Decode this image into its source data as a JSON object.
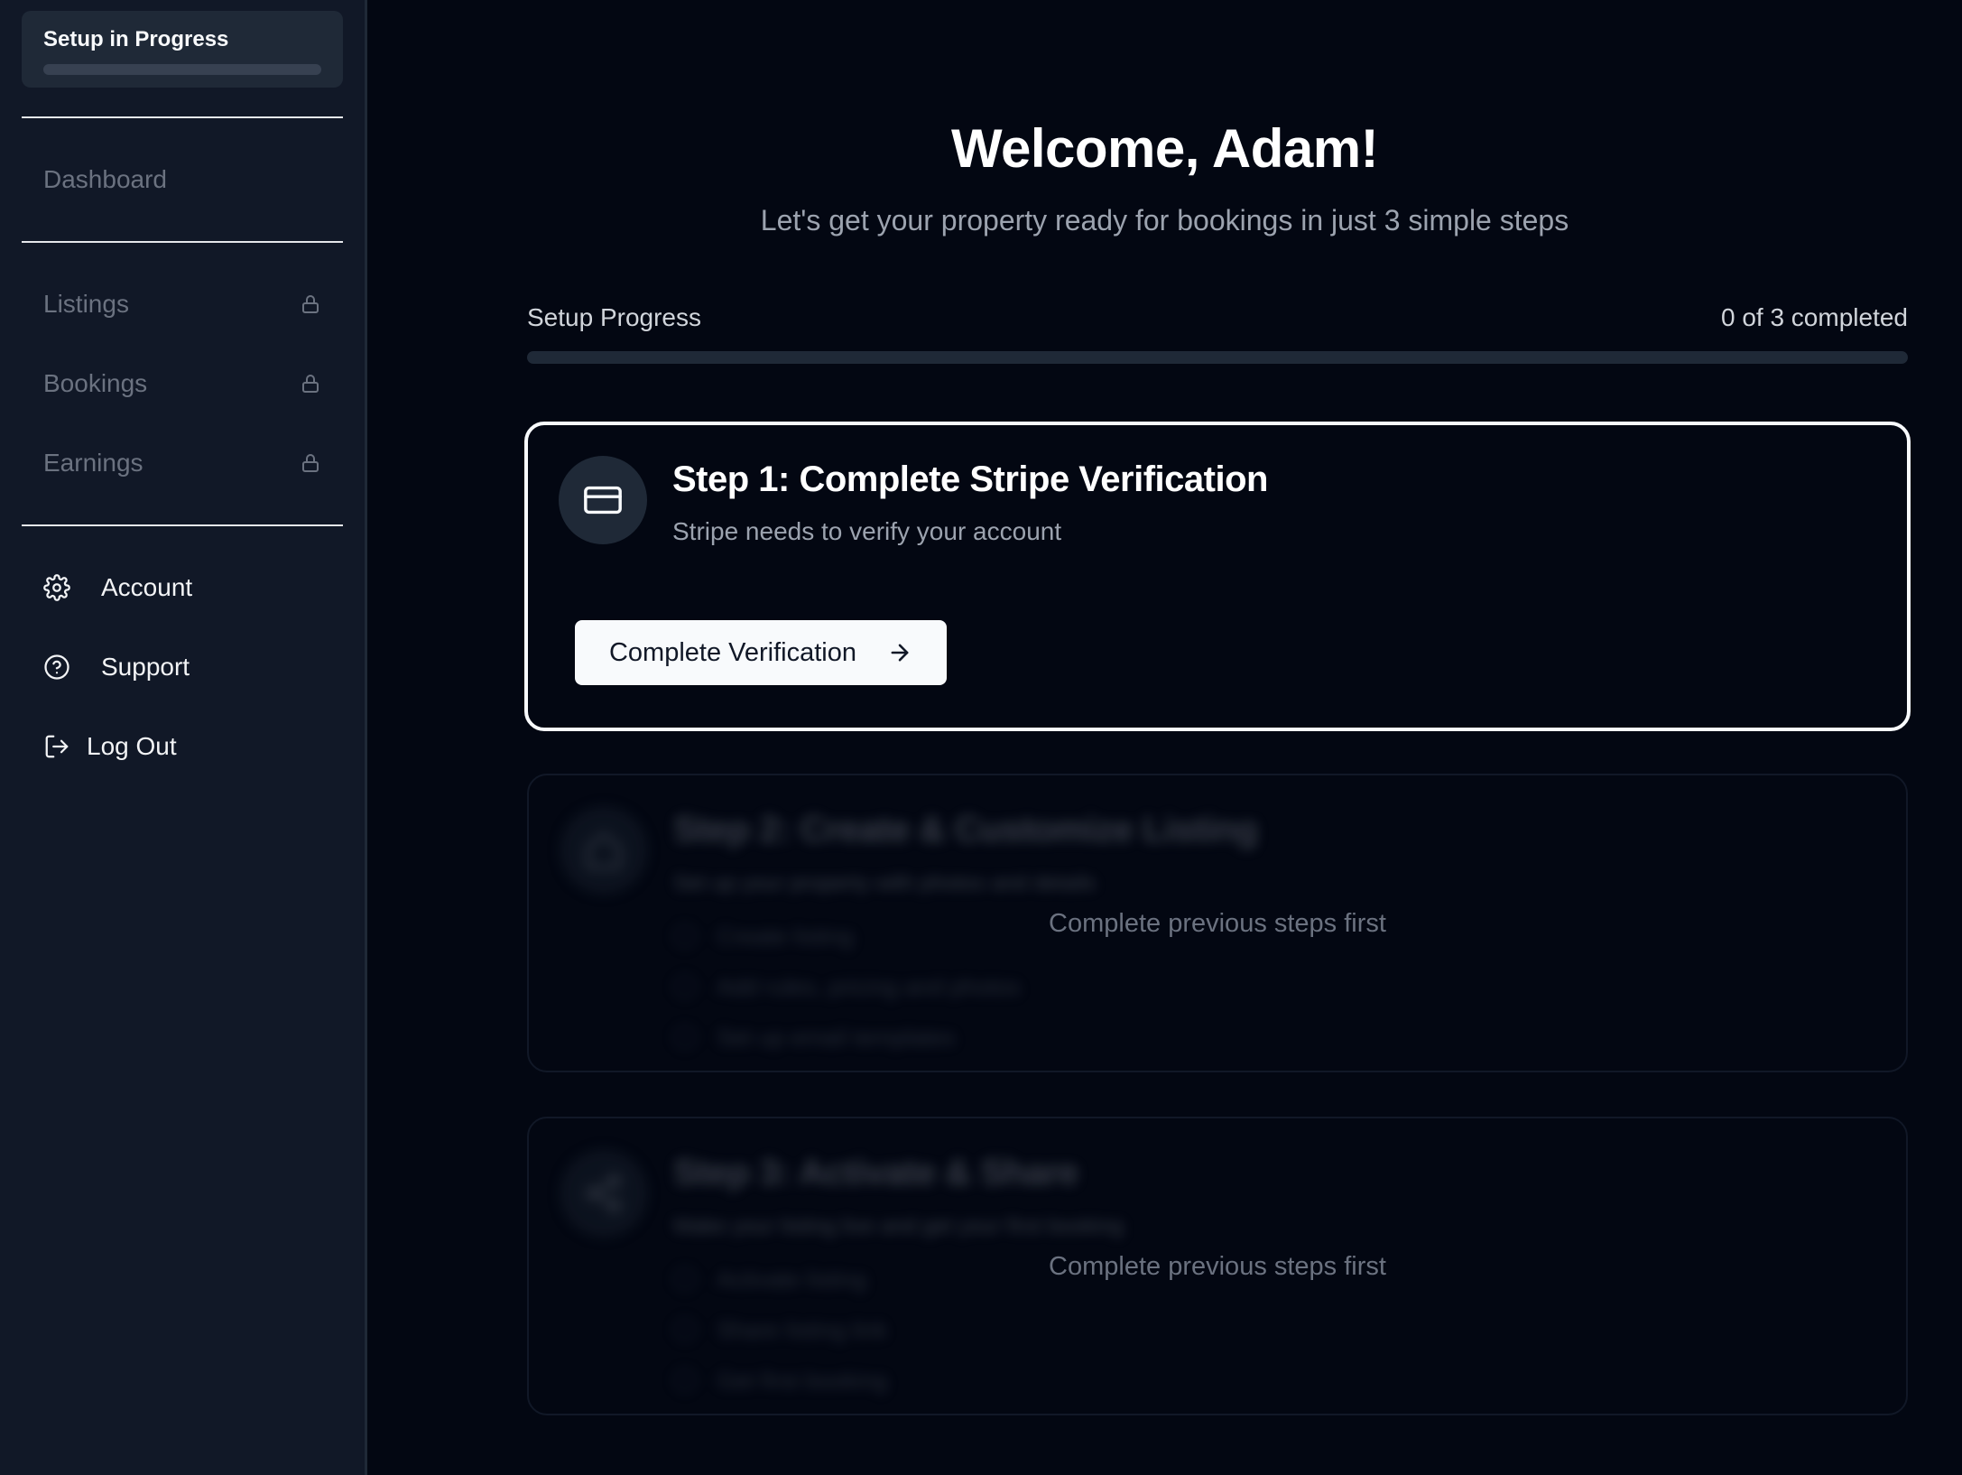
{
  "sidebar": {
    "setup_status": {
      "label": "Setup in Progress",
      "progress": 0
    },
    "nav_top": [
      {
        "label": "Dashboard"
      }
    ],
    "nav_locked": [
      {
        "label": "Listings",
        "icon": "lock-icon"
      },
      {
        "label": "Bookings",
        "icon": "lock-icon"
      },
      {
        "label": "Earnings",
        "icon": "lock-icon"
      }
    ],
    "nav_bottom": [
      {
        "label": "Account",
        "icon": "gear-icon"
      },
      {
        "label": "Support",
        "icon": "help-circle-icon"
      },
      {
        "label": "Log Out",
        "icon": "log-out-icon"
      }
    ]
  },
  "main": {
    "title": "Welcome, Adam!",
    "subtitle": "Let's get your property ready for bookings in just 3 simple steps",
    "progress": {
      "label": "Setup Progress",
      "status": "0 of 3 completed",
      "completed": 0,
      "total": 3
    },
    "steps": [
      {
        "title": "Step 1: Complete Stripe Verification",
        "description": "Stripe needs to verify your account",
        "icon": "credit-card-icon",
        "button_label": "Complete Verification",
        "button_icon": "arrow-right-icon"
      },
      {
        "title": "Step 2: Create & Customize Listing",
        "description": "Set up your property with photos and details",
        "icon": "home-icon",
        "tasks": [
          "Create listing",
          "Add rules, pricing and photos",
          "Set up email templates"
        ],
        "locked_message": "Complete previous steps first"
      },
      {
        "title": "Step 3: Activate & Share",
        "description": "Make your listing live and get your first booking",
        "icon": "share-icon",
        "tasks": [
          "Activate listing",
          "Share listing link",
          "Get first booking"
        ],
        "locked_message": "Complete previous steps first"
      }
    ]
  },
  "colors": {
    "background": "#030712",
    "sidebar": "#111827",
    "accent": "#f8fafc",
    "muted": "#6b7280"
  }
}
